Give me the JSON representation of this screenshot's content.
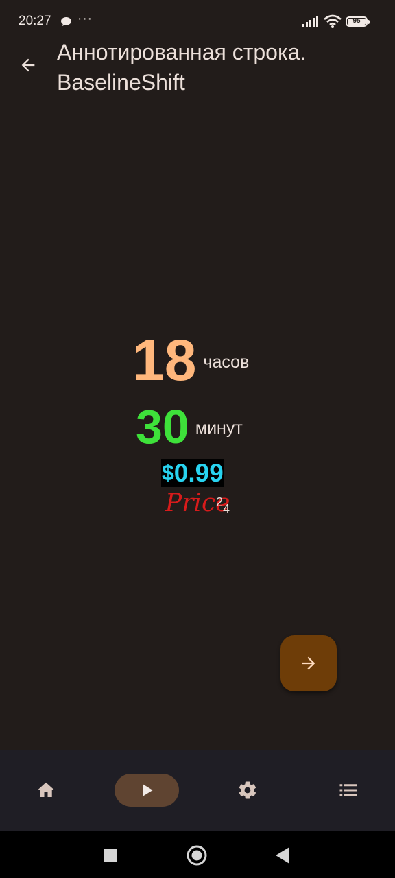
{
  "status_bar": {
    "time": "20:27",
    "more": "···",
    "battery_level": "95",
    "icons": [
      "chat-bubble-icon",
      "more-icon",
      "signal-icon",
      "wifi-icon",
      "battery-icon"
    ]
  },
  "app_bar": {
    "title": "Аннотированная строка. BaselineShift",
    "back_icon": "arrow-back-icon"
  },
  "content": {
    "hours_value": "18",
    "hours_unit": "часов",
    "minutes_value": "30",
    "minutes_unit": "минут",
    "price_currency": "$",
    "price_amount": "0.99",
    "price_word": "Price",
    "price_superscript": "2",
    "price_subscript": "4"
  },
  "fab": {
    "icon": "arrow-forward-icon"
  },
  "bottom_nav": {
    "items": [
      {
        "icon": "home-icon",
        "selected": false
      },
      {
        "icon": "play-icon",
        "selected": true
      },
      {
        "icon": "settings-icon",
        "selected": false
      },
      {
        "icon": "list-icon",
        "selected": false
      }
    ]
  },
  "system_nav": {
    "items": [
      "recents-icon",
      "home-circle-icon",
      "back-triangle-icon"
    ]
  },
  "colors": {
    "background": "#221c1a",
    "hours": "#ffb77c",
    "minutes": "#3ee13a",
    "price": "#28d3f0",
    "price_word": "#d81b1b",
    "fab": "#6e3d08",
    "nav_background": "#1f1e25",
    "nav_selected": "#5f4431"
  }
}
